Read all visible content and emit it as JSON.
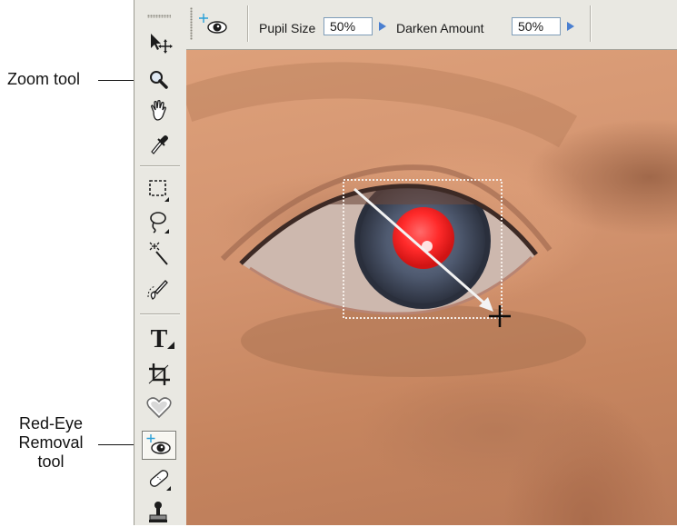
{
  "callouts": {
    "zoom_tool": "Zoom tool",
    "redeye_tool": [
      "Red-Eye",
      "Removal",
      "tool"
    ]
  },
  "options_bar": {
    "tool_icon": "red-eye-tool-icon",
    "pupil_size_label": "Pupil Size",
    "pupil_size_value": "50%",
    "darken_amount_label": "Darken Amount",
    "darken_amount_value": "50%"
  },
  "toolbox": {
    "tools": [
      "move-tool-icon",
      "zoom-tool-icon",
      "hand-tool-icon",
      "eyedropper-tool-icon",
      "marquee-tool-icon",
      "lasso-tool-icon",
      "magic-wand-tool-icon",
      "quick-selection-tool-icon",
      "type-tool-icon",
      "crop-tool-icon",
      "cookie-cutter-tool-icon",
      "red-eye-removal-tool-icon",
      "spot-healing-brush-tool-icon",
      "clone-stamp-tool-icon"
    ],
    "type_tool_glyph": "T",
    "active_tool": "red-eye-removal-tool-icon"
  },
  "colors": {
    "panel": "#e9e8e2",
    "field_border": "#7f9db9",
    "arrow_blue": "#4a7fd0",
    "red_pupil": "#ff2a2a",
    "skin": "#d39470"
  }
}
